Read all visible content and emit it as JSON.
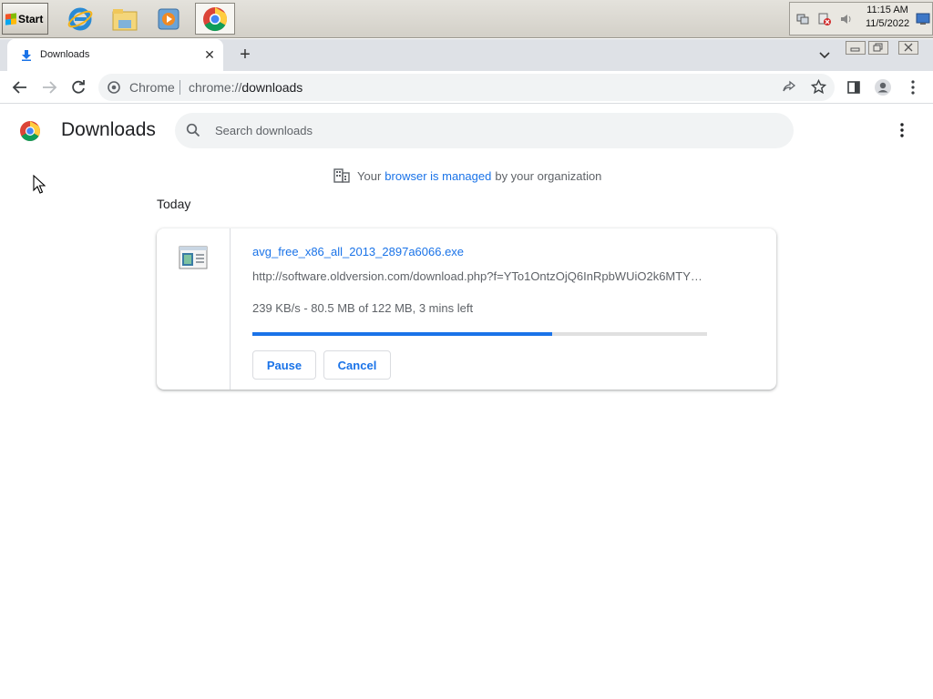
{
  "taskbar": {
    "start_label": "Start",
    "apps": [
      "internet-explorer",
      "file-explorer",
      "media-player",
      "chrome"
    ],
    "clock_time": "11:15 AM",
    "clock_date": "11/5/2022"
  },
  "browser": {
    "tab_title": "Downloads",
    "omnibox_chip": "Chrome",
    "url_scheme": "chrome://",
    "url_path": "downloads"
  },
  "page": {
    "title": "Downloads",
    "search_placeholder": "Search downloads",
    "managed_prefix": "Your",
    "managed_link": "browser is managed",
    "managed_suffix": "by your organization",
    "section_date": "Today"
  },
  "download": {
    "file_name": "avg_free_x86_all_2013_2897a6066.exe",
    "url": "http://software.oldversion.com/download.php?f=YTo1OntzOjQ6InRpbWUiO2k6MTY2…",
    "status": "239 KB/s - 80.5 MB of 122 MB, 3 mins left",
    "progress_fraction": 0.66,
    "pause_label": "Pause",
    "cancel_label": "Cancel"
  },
  "colors": {
    "accent": "#1a73e8",
    "secondary_text": "#5f6368",
    "tabstrip": "#dee1e6"
  }
}
